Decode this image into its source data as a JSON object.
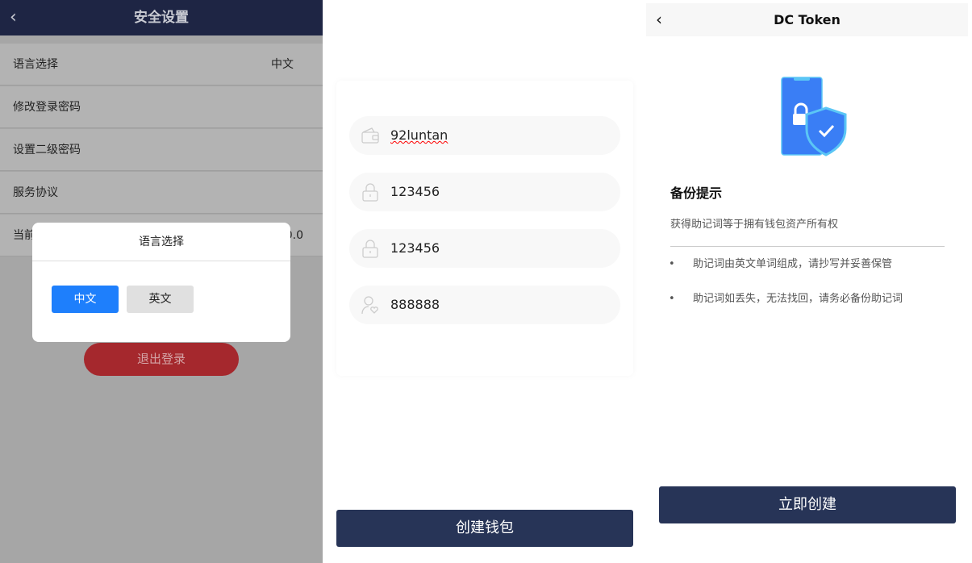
{
  "security": {
    "title": "安全设置",
    "back": "‹",
    "rows": [
      {
        "label": "语言选择",
        "value": "中文"
      },
      {
        "label": "修改登录密码"
      },
      {
        "label": "设置二级密码"
      },
      {
        "label": "服务协议"
      },
      {
        "label": "当前",
        "value": "0.0"
      }
    ],
    "modal": {
      "title": "语言选择",
      "options": [
        "中文",
        "英文"
      ],
      "selected": "中文"
    },
    "logout": "退出登录"
  },
  "create": {
    "fields": [
      {
        "icon": "wallet-icon",
        "value": "92luntan"
      },
      {
        "icon": "lock-icon",
        "value": "123456"
      },
      {
        "icon": "lock-icon",
        "value": "123456"
      },
      {
        "icon": "user-icon",
        "value": "888888"
      }
    ],
    "button": "创建钱包"
  },
  "backup": {
    "title": "DC Token",
    "back": "‹",
    "heading": "备份提示",
    "subtitle": "获得助记词等于拥有钱包资产所有权",
    "bullets": [
      "助记词由英文单词组成，请抄写并妥善保管",
      "助记词如丢失，无法找回，请务必备份助记词"
    ],
    "button": "立即创建"
  },
  "colors": {
    "navy": "#273457",
    "blue": "#1e7ffc",
    "red": "#a5282d"
  }
}
